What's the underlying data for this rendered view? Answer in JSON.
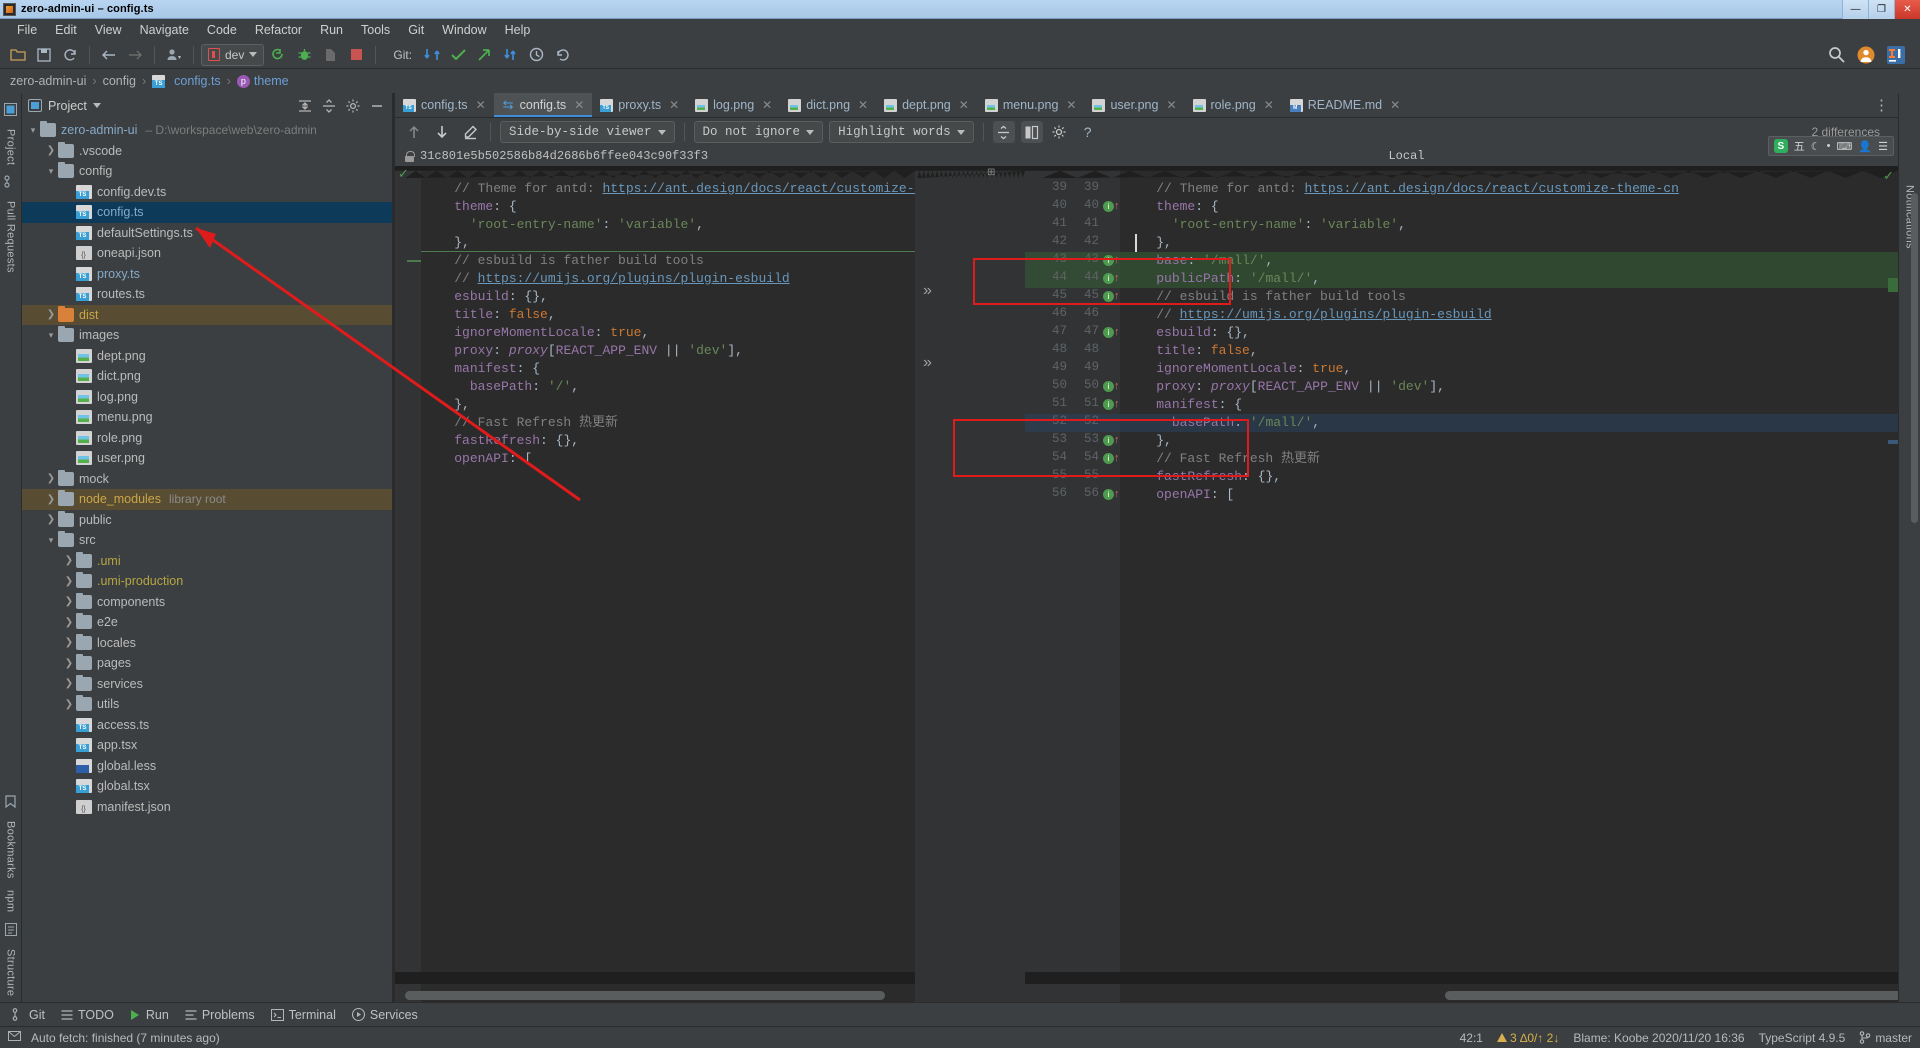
{
  "window": {
    "title": "zero-admin-ui – config.ts",
    "buttons": {
      "minimize": "—",
      "maximize": "❐",
      "close": "✕"
    }
  },
  "menubar": [
    "File",
    "Edit",
    "View",
    "Navigate",
    "Code",
    "Refactor",
    "Run",
    "Tools",
    "Git",
    "Window",
    "Help"
  ],
  "toolbar": {
    "run_config": "dev",
    "git_label": "Git:",
    "icons": [
      "open-folder",
      "save-all",
      "sync",
      "back",
      "forward",
      "profile",
      "run",
      "debug",
      "coverage",
      "stop",
      "update-project",
      "commit",
      "push",
      "rollback-update",
      "history",
      "undo",
      "search-everywhere",
      "user-avatar",
      "ide-logo"
    ]
  },
  "breadcrumb": [
    {
      "label": "zero-admin-ui",
      "kind": "module"
    },
    {
      "label": "config",
      "kind": "folder"
    },
    {
      "label": "config.ts",
      "kind": "ts"
    },
    {
      "label": "theme",
      "kind": "property"
    }
  ],
  "left_rail": [
    "Project",
    "Pull Requests",
    "Bookmarks",
    "npm",
    "Structure"
  ],
  "right_rail": [
    "Notifications"
  ],
  "project_panel": {
    "title": "Project",
    "tree": [
      {
        "depth": 0,
        "arrow": "down",
        "icon": "folder",
        "label": "zero-admin-ui",
        "sub": "– D:\\workspace\\web\\zero-admin",
        "color": "blue"
      },
      {
        "depth": 1,
        "arrow": "right",
        "icon": "folder",
        "label": ".vscode"
      },
      {
        "depth": 1,
        "arrow": "down",
        "icon": "folder",
        "label": "config"
      },
      {
        "depth": 2,
        "arrow": "none",
        "icon": "ts",
        "label": "config.dev.ts"
      },
      {
        "depth": 2,
        "arrow": "none",
        "icon": "ts",
        "label": "config.ts",
        "state": "selected",
        "color": "blue"
      },
      {
        "depth": 2,
        "arrow": "none",
        "icon": "ts",
        "label": "defaultSettings.ts"
      },
      {
        "depth": 2,
        "arrow": "none",
        "icon": "json",
        "label": "oneapi.json"
      },
      {
        "depth": 2,
        "arrow": "none",
        "icon": "ts",
        "label": "proxy.ts",
        "color": "blue"
      },
      {
        "depth": 2,
        "arrow": "none",
        "icon": "ts",
        "label": "routes.ts"
      },
      {
        "depth": 1,
        "arrow": "right",
        "icon": "folder-orange",
        "label": "dist",
        "state": "highlight",
        "color": "orange"
      },
      {
        "depth": 1,
        "arrow": "down",
        "icon": "folder",
        "label": "images"
      },
      {
        "depth": 2,
        "arrow": "none",
        "icon": "png",
        "label": "dept.png"
      },
      {
        "depth": 2,
        "arrow": "none",
        "icon": "png",
        "label": "dict.png"
      },
      {
        "depth": 2,
        "arrow": "none",
        "icon": "png",
        "label": "log.png"
      },
      {
        "depth": 2,
        "arrow": "none",
        "icon": "png",
        "label": "menu.png"
      },
      {
        "depth": 2,
        "arrow": "none",
        "icon": "png",
        "label": "role.png"
      },
      {
        "depth": 2,
        "arrow": "none",
        "icon": "png",
        "label": "user.png"
      },
      {
        "depth": 1,
        "arrow": "right",
        "icon": "folder",
        "label": "mock"
      },
      {
        "depth": 1,
        "arrow": "right",
        "icon": "folder",
        "label": "node_modules",
        "sub": "library root",
        "state": "highlight",
        "color": "orange"
      },
      {
        "depth": 1,
        "arrow": "right",
        "icon": "folder",
        "label": "public"
      },
      {
        "depth": 1,
        "arrow": "down",
        "icon": "folder",
        "label": "src"
      },
      {
        "depth": 2,
        "arrow": "right",
        "icon": "folder",
        "label": ".umi",
        "color": "yellow"
      },
      {
        "depth": 2,
        "arrow": "right",
        "icon": "folder",
        "label": ".umi-production",
        "color": "yellow"
      },
      {
        "depth": 2,
        "arrow": "right",
        "icon": "folder",
        "label": "components"
      },
      {
        "depth": 2,
        "arrow": "right",
        "icon": "folder",
        "label": "e2e"
      },
      {
        "depth": 2,
        "arrow": "right",
        "icon": "folder",
        "label": "locales"
      },
      {
        "depth": 2,
        "arrow": "right",
        "icon": "folder",
        "label": "pages"
      },
      {
        "depth": 2,
        "arrow": "right",
        "icon": "folder",
        "label": "services"
      },
      {
        "depth": 2,
        "arrow": "right",
        "icon": "folder",
        "label": "utils"
      },
      {
        "depth": 2,
        "arrow": "none",
        "icon": "ts",
        "label": "access.ts"
      },
      {
        "depth": 2,
        "arrow": "none",
        "icon": "tsx",
        "label": "app.tsx"
      },
      {
        "depth": 2,
        "arrow": "none",
        "icon": "less",
        "label": "global.less"
      },
      {
        "depth": 2,
        "arrow": "none",
        "icon": "tsx",
        "label": "global.tsx"
      },
      {
        "depth": 2,
        "arrow": "none",
        "icon": "json",
        "label": "manifest.json"
      }
    ]
  },
  "tabs": [
    {
      "label": "config.ts",
      "icon": "ts",
      "active": false
    },
    {
      "label": "config.ts",
      "icon": "diff",
      "active": true
    },
    {
      "label": "proxy.ts",
      "icon": "ts",
      "active": false
    },
    {
      "label": "log.png",
      "icon": "png",
      "active": false
    },
    {
      "label": "dict.png",
      "icon": "png",
      "active": false
    },
    {
      "label": "dept.png",
      "icon": "png",
      "active": false
    },
    {
      "label": "menu.png",
      "icon": "png",
      "active": false
    },
    {
      "label": "user.png",
      "icon": "png",
      "active": false
    },
    {
      "label": "role.png",
      "icon": "png",
      "active": false
    },
    {
      "label": "README.md",
      "icon": "md",
      "active": false
    }
  ],
  "diff_toolbar": {
    "viewer_mode": "Side-by-side viewer",
    "ignore_mode": "Do not ignore",
    "highlight_mode": "Highlight words",
    "help": "?",
    "differences_label": "2 differences"
  },
  "diff_headers": {
    "left_revision": "31c801e5b502586b84d2686b6ffee043c90f33f3",
    "right_title": "Local"
  },
  "diff": {
    "left_lines": [
      "    // Theme for antd: https://ant.design/docs/react/customize-theme-c",
      "    theme: {",
      "      'root-entry-name': 'variable',",
      "    },",
      "    // esbuild is father build tools",
      "    // https://umijs.org/plugins/plugin-esbuild",
      "    esbuild: {},",
      "    title: false,",
      "    ignoreMomentLocale: true,",
      "    proxy: proxy[REACT_APP_ENV || 'dev'],",
      "    manifest: {",
      "      basePath: '/',",
      "    },",
      "    // Fast Refresh 热更新",
      "    fastRefresh: {},",
      "    openAPI: ["
    ],
    "right_lines": [
      {
        "old": "39",
        "new": "39",
        "text": "    // Theme for antd: https://ant.design/docs/react/customize-theme-cn"
      },
      {
        "old": "40",
        "new": "40",
        "text": "    theme: {"
      },
      {
        "old": "41",
        "new": "41",
        "text": "      'root-entry-name': 'variable',"
      },
      {
        "old": "42",
        "new": "42",
        "text": "    },"
      },
      {
        "old": "43",
        "new": "43",
        "text": "    base: '/mall/',",
        "change": "added"
      },
      {
        "old": "44",
        "new": "44",
        "text": "    publicPath: '/mall/',",
        "change": "added"
      },
      {
        "old": "45",
        "new": "45",
        "text": "    // esbuild is father build tools"
      },
      {
        "old": "46",
        "new": "46",
        "text": "    // https://umijs.org/plugins/plugin-esbuild"
      },
      {
        "old": "47",
        "new": "47",
        "text": "    esbuild: {},"
      },
      {
        "old": "48",
        "new": "48",
        "text": "    title: false,"
      },
      {
        "old": "49",
        "new": "49",
        "text": "    ignoreMomentLocale: true,"
      },
      {
        "old": "50",
        "new": "50",
        "text": "    proxy: proxy[REACT_APP_ENV || 'dev'],"
      },
      {
        "old": "51",
        "new": "51",
        "text": "    manifest: {"
      },
      {
        "old": "52",
        "new": "52",
        "text": "      basePath: '/mall/',",
        "change": "modified"
      },
      {
        "old": "53",
        "new": "53",
        "text": "    },"
      },
      {
        "old": "54",
        "new": "54",
        "text": "    // Fast Refresh 热更新"
      },
      {
        "old": "55",
        "new": "55",
        "text": "    fastRefresh: {},"
      },
      {
        "old": "56",
        "new": "56",
        "text": "    openAPI: ["
      }
    ]
  },
  "bottom_bar": [
    {
      "label": "Git",
      "icon": "branch-icon"
    },
    {
      "label": "TODO",
      "icon": "list-icon"
    },
    {
      "label": "Run",
      "icon": "play-icon"
    },
    {
      "label": "Problems",
      "icon": "problems-icon"
    },
    {
      "label": "Terminal",
      "icon": "terminal-icon"
    },
    {
      "label": "Services",
      "icon": "services-icon"
    }
  ],
  "statusbar": {
    "message": "Auto fetch: finished (7 minutes ago)",
    "caret": "42:1",
    "inspections": "3 ∆0/↑ 2↓",
    "blame": "Blame: Koobe 2020/11/20 16:36",
    "language": "TypeScript 4.9.5",
    "branch": "master",
    "warn_count": "3"
  },
  "ime": {
    "lang": "五",
    "items": [
      "moon-icon",
      "keyboard-icon",
      "user-icon",
      "menu-icon"
    ]
  },
  "colors": {
    "accent_blue": "#3d8ddb",
    "added_green": "#345e34",
    "modified_blue": "#2a425c",
    "annotation_red": "#e01b1b",
    "panel_bg": "#3c3f41",
    "editor_bg": "#2b2b2b"
  }
}
